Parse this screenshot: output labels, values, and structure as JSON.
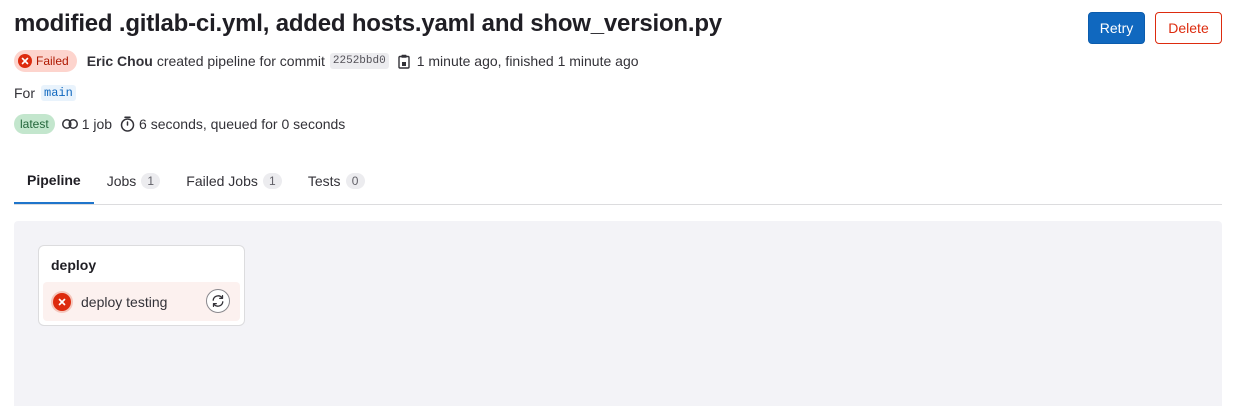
{
  "pipeline": {
    "title": "modified .gitlab-ci.yml, added hosts.yaml and show_version.py",
    "status_label": "Failed",
    "author": "Eric Chou",
    "created_text": "created pipeline for commit",
    "commit_sha": "2252bbd0",
    "time_text": "1 minute ago, finished 1 minute ago",
    "for_label": "For",
    "branch": "main",
    "latest_label": "latest",
    "job_count_text": "1 job",
    "duration_text": "6 seconds, queued for 0 seconds"
  },
  "actions": {
    "retry_label": "Retry",
    "delete_label": "Delete"
  },
  "tabs": [
    {
      "label": "Pipeline",
      "count": null
    },
    {
      "label": "Jobs",
      "count": "1"
    },
    {
      "label": "Failed Jobs",
      "count": "1"
    },
    {
      "label": "Tests",
      "count": "0"
    }
  ],
  "graph": {
    "stage_name": "deploy",
    "job_name": "deploy testing"
  },
  "colors": {
    "failed": "#dd2b0e",
    "primary": "#1068bf",
    "latest_bg": "#c3e6cd"
  },
  "icons": {
    "status": "status-failed-icon",
    "copy": "copy-to-clipboard-icon",
    "jobs": "pipeline-jobs-icon",
    "duration": "timer-icon",
    "retry_job": "retry-icon"
  }
}
